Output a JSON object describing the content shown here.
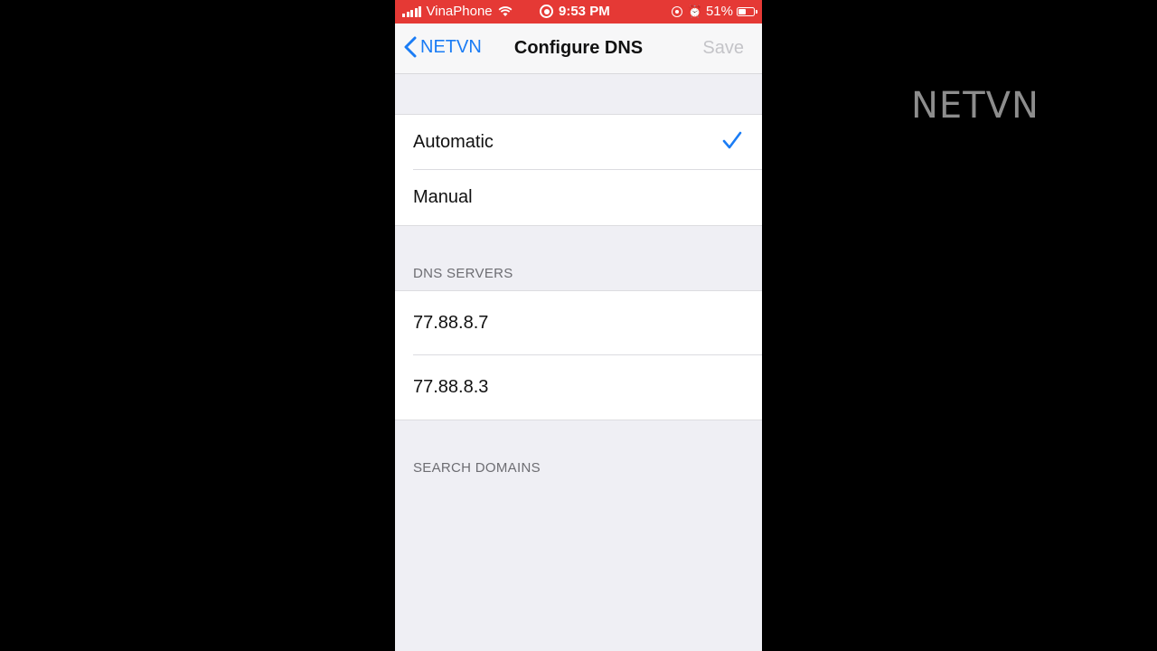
{
  "watermark": "NETVN",
  "status_bar": {
    "carrier": "VinaPhone",
    "time": "9:53 PM",
    "battery_percent": "51%",
    "battery_level": 0.51,
    "color": "#e53935"
  },
  "nav": {
    "back_label": "NETVN",
    "title": "Configure DNS",
    "save_label": "Save"
  },
  "mode_options": [
    {
      "label": "Automatic",
      "selected": true
    },
    {
      "label": "Manual",
      "selected": false
    }
  ],
  "dns_section": {
    "header": "DNS SERVERS",
    "servers": [
      "77.88.8.7",
      "77.88.8.3"
    ]
  },
  "search_section": {
    "header": "SEARCH DOMAINS"
  },
  "colors": {
    "accent": "#1a7cf5",
    "background": "#efeff4",
    "disabled": "#c4c4c8"
  }
}
